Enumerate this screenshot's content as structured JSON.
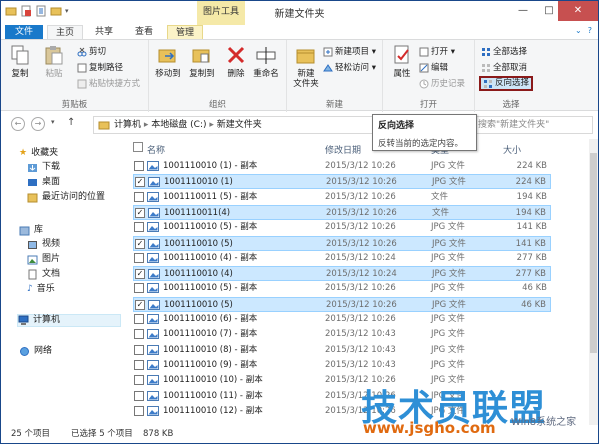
{
  "window": {
    "title": "新建文件夹",
    "context_tab": "图片工具",
    "close_symbol": "✕",
    "max_symbol": "□",
    "min_symbol": "—"
  },
  "tabs": [
    "文件",
    "主页",
    "共享",
    "查看",
    "管理"
  ],
  "ribbon": {
    "clipboard": {
      "label": "剪贴板",
      "copy": "复制",
      "paste": "粘贴",
      "cut": "剪切",
      "copy_path": "复制路径",
      "paste_shortcut": "粘贴快捷方式"
    },
    "organize": {
      "label": "组织",
      "move_to": "移动到",
      "copy_to": "复制到",
      "delete": "删除",
      "rename": "重命名"
    },
    "new": {
      "label": "新建",
      "new_folder_line1": "新建",
      "new_folder_line2": "文件夹",
      "new_item": "新建项目 ▾",
      "easy_access": "轻松访问 ▾"
    },
    "open": {
      "label": "打开",
      "properties": "属性",
      "open": "打开 ▾",
      "edit": "编辑",
      "history": "历史记录"
    },
    "select": {
      "label": "选择",
      "select_all": "全部选择",
      "select_none": "全部取消",
      "invert": "反向选择"
    }
  },
  "address": {
    "crumbs": [
      "计算机",
      "本地磁盘 (C:)",
      "新建文件夹"
    ],
    "search_placeholder": "搜索\"新建文件夹\""
  },
  "tooltip": {
    "title": "反向选择",
    "body": "反转当前的选定内容。"
  },
  "nav": {
    "favorites": "收藏夹",
    "downloads": "下载",
    "desktop": "桌面",
    "recent": "最近访问的位置",
    "libraries": "库",
    "videos": "视频",
    "pictures": "图片",
    "documents": "文档",
    "music": "音乐",
    "computer": "计算机",
    "network": "网络"
  },
  "columns": {
    "name": "名称",
    "date": "修改日期",
    "type": "类型",
    "size": "大小"
  },
  "files": [
    {
      "name": "1001110010 (1) - 副本",
      "date": "2015/3/12 10:26",
      "type": "JPG 文件",
      "size": "224 KB",
      "selected": false
    },
    {
      "name": "1001110010 (1)",
      "date": "2015/3/12 10:26",
      "type": "JPG 文件",
      "size": "224 KB",
      "selected": true
    },
    {
      "name": "1001110011 (5) - 副本",
      "date": "2015/3/12 10:26",
      "type": "文件",
      "size": "194 KB",
      "selected": false
    },
    {
      "name": "1001110011(4)",
      "date": "2015/3/12 10:26",
      "type": "文件",
      "size": "194 KB",
      "selected": true
    },
    {
      "name": "1001110010 (5) - 副本",
      "date": "2015/3/12 10:26",
      "type": "JPG 文件",
      "size": "141 KB",
      "selected": false
    },
    {
      "name": "1001110010 (5)",
      "date": "2015/3/12 10:26",
      "type": "JPG 文件",
      "size": "141 KB",
      "selected": true
    },
    {
      "name": "1001110010 (4) - 副本",
      "date": "2015/3/12 10:24",
      "type": "JPG 文件",
      "size": "277 KB",
      "selected": false
    },
    {
      "name": "1001110010 (4)",
      "date": "2015/3/12 10:24",
      "type": "JPG 文件",
      "size": "277 KB",
      "selected": true
    },
    {
      "name": "1001110010 (5) - 副本",
      "date": "2015/3/12 10:26",
      "type": "JPG 文件",
      "size": "46 KB",
      "selected": false
    },
    {
      "name": "1001110010 (5)",
      "date": "2015/3/12 10:26",
      "type": "JPG 文件",
      "size": "46 KB",
      "selected": true
    },
    {
      "name": "1001110010 (6) - 副本",
      "date": "2015/3/12 10:26",
      "type": "JPG 文件",
      "size": "",
      "selected": false
    },
    {
      "name": "1001110010 (7) - 副本",
      "date": "2015/3/12 10:43",
      "type": "JPG 文件",
      "size": "",
      "selected": false
    },
    {
      "name": "1001110010 (8) - 副本",
      "date": "2015/3/12 10:43",
      "type": "JPG 文件",
      "size": "",
      "selected": false
    },
    {
      "name": "1001110010 (9) - 副本",
      "date": "2015/3/12 10:43",
      "type": "JPG 文件",
      "size": "",
      "selected": false
    },
    {
      "name": "1001110010 (10) - 副本",
      "date": "2015/3/12 10:26",
      "type": "JPG 文件",
      "size": "",
      "selected": false
    },
    {
      "name": "1001110010 (11) - 副本",
      "date": "2015/3/12 10:26",
      "type": "JPG 文件",
      "size": "",
      "selected": false
    },
    {
      "name": "1001110010 (12) - 副本",
      "date": "2015/3/12 10:26",
      "type": "JPG 文件",
      "size": "",
      "selected": false
    }
  ],
  "status": {
    "count": "25 个项目",
    "selection": "已选择 5 个项目",
    "selection_size": "878 KB"
  },
  "watermark": {
    "brand": "技术员联盟",
    "url": "www.jsgho.com",
    "tag": "Win8系统之家"
  },
  "colors": {
    "accent": "#1979ca",
    "selection": "#cce8ff",
    "highlight_border": "#8b1a1a",
    "context_tab": "#f5e9a8"
  }
}
